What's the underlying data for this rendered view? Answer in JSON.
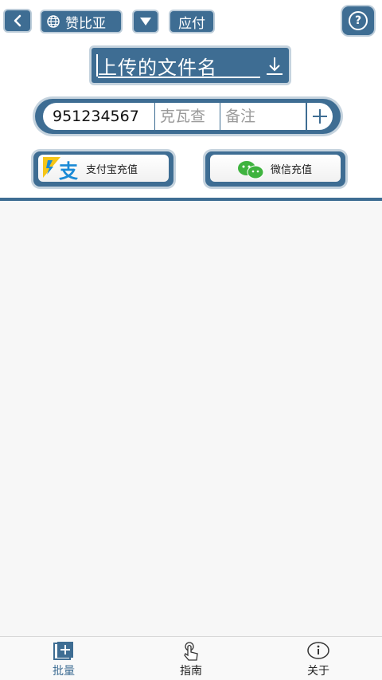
{
  "topbar": {
    "back_icon": "chevron-left-icon",
    "country_label": "赞比亚",
    "globe_icon": "globe-icon",
    "dropdown_icon": "triangle-down-icon",
    "mode_label": "应付",
    "help_icon": "question-circle-icon",
    "help_glyph": "?"
  },
  "upload": {
    "title": "上传的文件名",
    "icon": "download-arrow-icon"
  },
  "entry": {
    "number_value": "951234567",
    "currency_placeholder": "克瓦查",
    "note_placeholder": "备注",
    "add_glyph": "+"
  },
  "payments": {
    "alipay_label": "支付宝充值",
    "alipay_icon": "alipay-icon",
    "wechat_label": "微信充值",
    "wechat_icon": "wechat-icon"
  },
  "bottom_nav": {
    "items": [
      {
        "label": "批量",
        "icon": "batch-add-icon",
        "active": true
      },
      {
        "label": "指南",
        "icon": "touch-hand-icon",
        "active": false
      },
      {
        "label": "关于",
        "icon": "info-icon",
        "active": false
      }
    ]
  },
  "colors": {
    "accent": "#3e6d93",
    "background": "#f7f7f7",
    "alipay_yellow": "#f5c518",
    "alipay_blue": "#1a8ad6",
    "wechat_green": "#3fb33f"
  }
}
